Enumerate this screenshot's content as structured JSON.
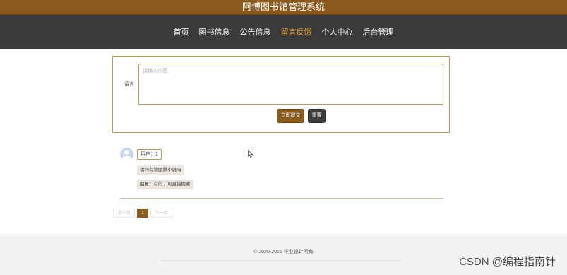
{
  "header": {
    "title": "阿博图书馆管理系统"
  },
  "nav": {
    "items": [
      "首页",
      "图书信息",
      "公告信息",
      "留言反馈",
      "个人中心",
      "后台管理"
    ],
    "active_index": 3
  },
  "colors": {
    "brand": "#8a5a1f",
    "nav_bg": "#3b3b3b",
    "active": "#e2a23a"
  },
  "form": {
    "label": "留言",
    "placeholder": "请输入内容",
    "submit_label": "立即提交",
    "reset_label": "重置"
  },
  "messages": [
    {
      "user": "用户：1",
      "content": "请问有锦图腾小说吗",
      "reply": "回复：有的，可直接搜索"
    }
  ],
  "pagination": {
    "prev": "上一页",
    "current": "1",
    "next": "下一页"
  },
  "footer": {
    "copyright": "© 2020-2021 毕业设计所有"
  },
  "watermark": "CSDN @编程指南针"
}
